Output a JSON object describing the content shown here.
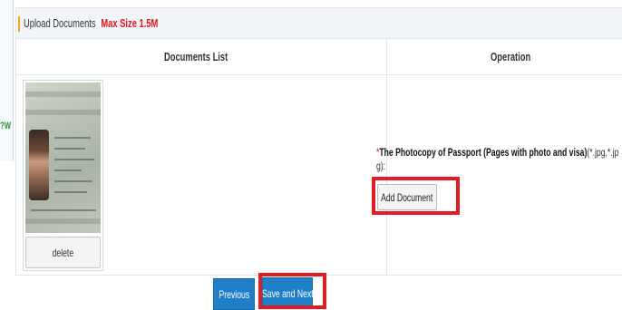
{
  "side": {
    "snippet": "?W"
  },
  "upload": {
    "title": "Upload Documents",
    "max_size": "Max Size 1.5M"
  },
  "table": {
    "col_documents": "Documents List",
    "col_operation": "Operation"
  },
  "document": {
    "image_icon": "passport-photo",
    "delete_label": "delete"
  },
  "operation": {
    "required_mark": "*",
    "requirement": "The Photocopy of Passport (Pages with photo and visa)",
    "extensions": "(*.jpg,*.jp",
    "extensions_cont": "g):",
    "add_label": "Add Document"
  },
  "nav": {
    "previous_label": "Previous",
    "save_next_label": "Save and Next"
  },
  "colors": {
    "accent": "#f0a81c",
    "warning": "#e5131b",
    "primary_button": "#1e7fc7",
    "highlight": "#e11d22"
  }
}
